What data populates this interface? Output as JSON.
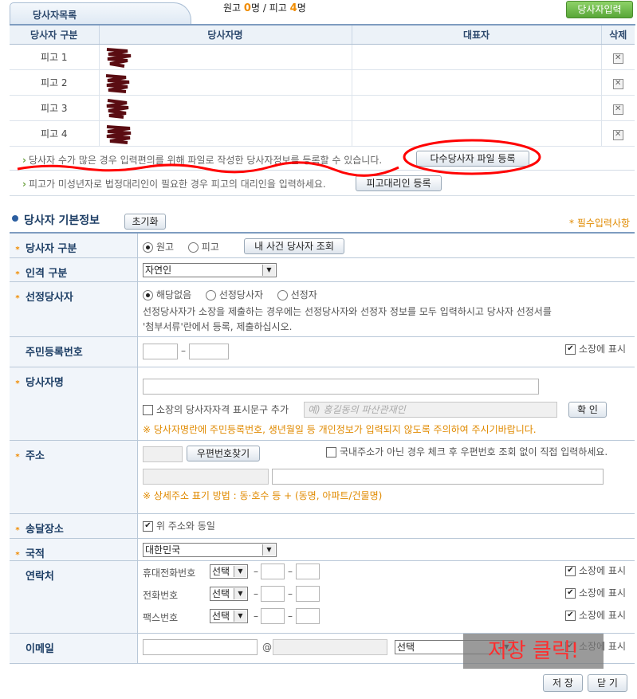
{
  "list_tab": {
    "title": "당사자목록"
  },
  "counts": {
    "plaintiff_label": "원고",
    "plaintiff_count": "0",
    "unit": "명",
    "sep": "/",
    "defendant_label": "피고",
    "defendant_count": "4"
  },
  "add_button": "당사자입력",
  "table": {
    "headers": [
      "당사자 구분",
      "당사자명",
      "대표자",
      "삭제"
    ],
    "rows": [
      {
        "type": "피고 1",
        "name": "",
        "rep": ""
      },
      {
        "type": "피고 2",
        "name": "",
        "rep": ""
      },
      {
        "type": "피고 3",
        "name": "",
        "rep": ""
      },
      {
        "type": "피고 4",
        "name": "",
        "rep": ""
      }
    ]
  },
  "notes": {
    "bulk_text": "당사자 수가 많은 경우 입력편의를 위해 파일로 작성한 당사자정보를 등록할 수 있습니다.",
    "bulk_button": "다수당사자 파일 등록",
    "minor_text": "피고가 미성년자로 법정대리인이 필요한 경우 피고의 대리인을 입력하세요.",
    "minor_button": "피고대리인 등록"
  },
  "basic": {
    "title": "당사자 기본정보",
    "reset_button": "초기화",
    "required_note": "* 필수입력사항",
    "type_label": "당사자 구분",
    "type_options": [
      "원고",
      "피고"
    ],
    "type_selected": "원고",
    "lookup_button": "내 사건 당사자 조회",
    "person_label": "인격 구분",
    "person_value": "자연인",
    "select_label": "선정당사자",
    "select_options": [
      "해당없음",
      "선정당사자",
      "선정자"
    ],
    "select_selected": "해당없음",
    "select_note_1": "선정당사자가 소장을 제출하는 경우에는 선정당사자와 선정자 정보를 모두 입력하시고 당사자 선정서를",
    "select_note_2": "'첨부서류'란에서 등록, 제출하십시오.",
    "rrn_label": "주민등록번호",
    "rrn_dash": "–",
    "show_on_complaint": "소장에 표시",
    "name_label": "당사자명",
    "qualifier_check": "소장의 당사자자격 표시문구 추가",
    "qualifier_placeholder": "예) 홍길동의 파산관재인",
    "confirm_button": "확 인",
    "name_warning": "※ 당사자명란에 주민등록번호, 생년월일 등 개인정보가 입력되지 않도록 주의하여 주시기바랍니다.",
    "address_label": "주소",
    "zip_button": "우편번호찾기",
    "foreign_check": "국내주소가 아닌 경우 체크 후 우편번호 조회 없이 직접 입력하세요.",
    "address_note": "※ 상세주소 표기 방법 : 동·호수 등 + (동명, 아파트/건물명)",
    "delivery_label": "송달장소",
    "delivery_check": "위 주소와 동일",
    "nation_label": "국적",
    "nation_value": "대한민국",
    "contact_label": "연락처",
    "mobile_label": "휴대전화번호",
    "phone_label": "전화번호",
    "fax_label": "팩스번호",
    "prefix_select": "선택",
    "email_label": "이메일",
    "email_at": "@",
    "email_select": "선택"
  },
  "footer": {
    "save_button": "저 장",
    "close_button": "닫 기"
  },
  "overlay_text": "저장 클릭!"
}
